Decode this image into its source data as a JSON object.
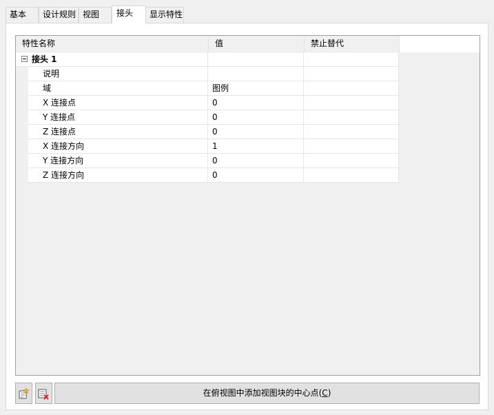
{
  "tabs": [
    {
      "label": "基本",
      "active": false
    },
    {
      "label": "设计规则",
      "active": false
    },
    {
      "label": "视图",
      "active": false
    },
    {
      "label": "接头",
      "active": true
    },
    {
      "label": "显示特性",
      "active": false
    }
  ],
  "grid": {
    "headers": [
      "特性名称",
      "值",
      "禁止替代"
    ],
    "group": {
      "name": "接头 1",
      "expanded": true
    },
    "rows": [
      {
        "name": "说明",
        "value": "",
        "override": ""
      },
      {
        "name": "域",
        "value": "图例",
        "override": ""
      },
      {
        "name": "X 连接点",
        "value": "0",
        "override": ""
      },
      {
        "name": "Y 连接点",
        "value": "0",
        "override": ""
      },
      {
        "name": "Z 连接点",
        "value": "0",
        "override": ""
      },
      {
        "name": "X 连接方向",
        "value": "1",
        "override": ""
      },
      {
        "name": "Y 连接方向",
        "value": "0",
        "override": ""
      },
      {
        "name": "Z 连接方向",
        "value": "0",
        "override": ""
      }
    ]
  },
  "buttons": {
    "add_icon": "add-item-icon",
    "delete_icon": "delete-item-icon",
    "main_label_prefix": "在俯视图中添加视图块的中心点(",
    "main_label_key": "C",
    "main_label_suffix": ")"
  }
}
